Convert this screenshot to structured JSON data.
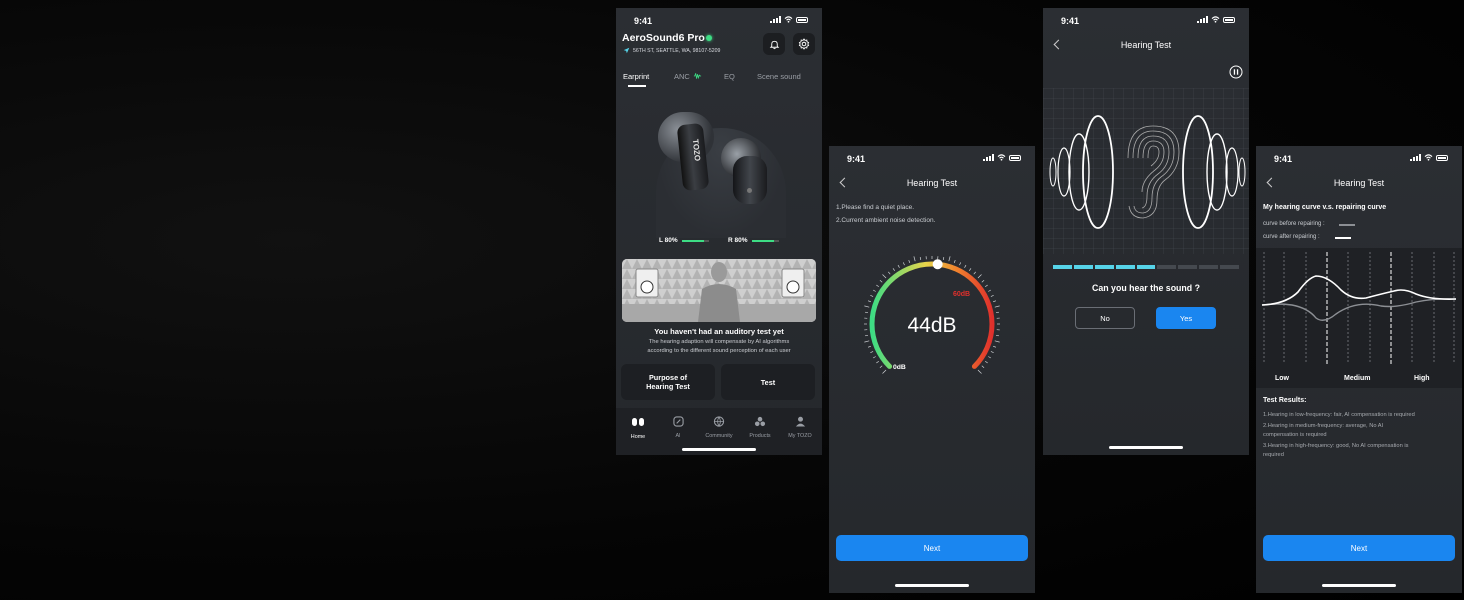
{
  "status_time": "9:41",
  "colors": {
    "accent": "#1a86f0",
    "battery_green": "#3ddc84",
    "teal": "#56d3e8"
  },
  "screen1": {
    "device_name": "AeroSound6 Pro",
    "address": "56TH ST, SEATTLE, WA, 98107-5209",
    "tabs": [
      "Earprint",
      "ANC",
      "EQ",
      "Scene sound"
    ],
    "active_tab": "Earprint",
    "earbud_brand": "TOZO",
    "battery_left": "L 80%",
    "battery_right": "R 80%",
    "battery_left_level": 0.8,
    "battery_right_level": 0.8,
    "banner_title": "You haven't had an auditory test yet",
    "banner_desc_line1": "The hearing adaption will compensate by AI  algorithms",
    "banner_desc_line2": "according to the different sound perception of each user",
    "purpose_button": "Purpose of Hearing Test",
    "test_button": "Test",
    "bottom_nav": [
      "Home",
      "AI",
      "Community",
      "Products",
      "My TOZO"
    ],
    "icons": {
      "bell": "bell-icon",
      "settings": "gear-icon",
      "location": "location-arrow-icon"
    }
  },
  "screen2": {
    "title": "Hearing Test",
    "instruction1": "1.Please find a quiet place.",
    "instruction2": "2.Current ambient noise detection.",
    "gauge_value": "44dB",
    "gauge_min": "0dB",
    "gauge_warn": "60dB",
    "gauge_level": 0.52,
    "next_button": "Next"
  },
  "screen3": {
    "title": "Hearing Test",
    "question": "Can you hear the sound ?",
    "no_button": "No",
    "yes_button": "Yes",
    "progress_done": 5,
    "progress_total": 9
  },
  "screen4": {
    "title": "Hearing Test",
    "curve_title": "My hearing curve v.s. repairing curve",
    "legend_before": "curve before repairing :",
    "legend_after": "curve after repairing :",
    "x_labels": [
      "Low",
      "Medium",
      "High"
    ],
    "results_title": "Test Results:",
    "result1": "1.Hearing in low-frequency: fair, AI compensation is required",
    "result2_l1": "2.Hearing in medium-frequency: average, No AI",
    "result2_l2": "compensation is required",
    "result3_l1": "3.Hearing in high-frequency: good, No AI compensation is",
    "result3_l2": "required",
    "next_button": "Next"
  }
}
